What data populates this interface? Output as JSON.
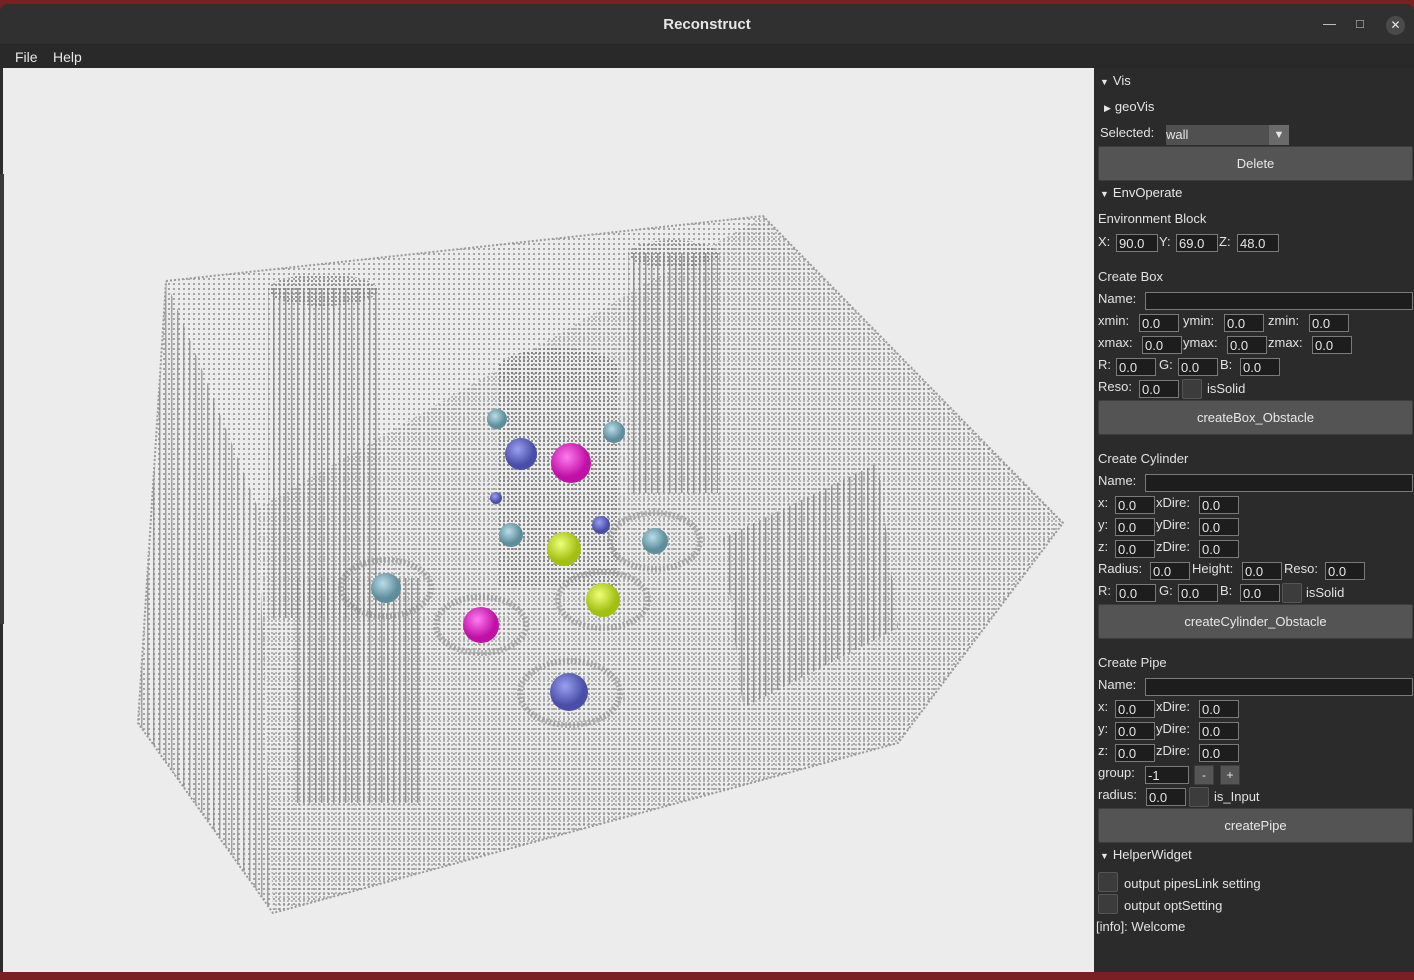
{
  "window": {
    "title": "Reconstruct"
  },
  "menu": [
    "File",
    "Help"
  ],
  "vis": {
    "header": "Vis",
    "geovis": "geoVis",
    "selected_label": "Selected:",
    "selected_value": "wall",
    "delete": "Delete"
  },
  "env": {
    "header": "EnvOperate",
    "block_title": "Environment Block",
    "x_label": "X:",
    "x": "90.0",
    "y_label": "Y:",
    "y": "69.0",
    "z_label": "Z:",
    "z": "48.0"
  },
  "box": {
    "title": "Create Box",
    "name_label": "Name:",
    "name": "",
    "xmin_label": "xmin:",
    "xmin": "0.0",
    "ymin_label": "ymin:",
    "ymin": "0.0",
    "zmin_label": "zmin:",
    "zmin": "0.0",
    "xmax_label": "xmax:",
    "xmax": "0.0",
    "ymax_label": "ymax:",
    "ymax": "0.0",
    "zmax_label": "zmax:",
    "zmax": "0.0",
    "r_label": "R:",
    "r": "0.0",
    "g_label": "G:",
    "g": "0.0",
    "b_label": "B:",
    "b": "0.0",
    "reso_label": "Reso:",
    "reso": "0.0",
    "issolid": "isSolid",
    "button": "createBox_Obstacle"
  },
  "cyl": {
    "title": "Create Cylinder",
    "name_label": "Name:",
    "name": "",
    "x_label": "x:",
    "x": "0.0",
    "y_label": "y:",
    "y": "0.0",
    "z_label": "z:",
    "z": "0.0",
    "xdire_label": "xDire:",
    "xdire": "0.0",
    "ydire_label": "yDire:",
    "ydire": "0.0",
    "zdire_label": "zDire:",
    "zdire": "0.0",
    "radius_label": "Radius:",
    "radius": "0.0",
    "height_label": "Height:",
    "height": "0.0",
    "reso_label": "Reso:",
    "reso": "0.0",
    "r_label": "R:",
    "r": "0.0",
    "g_label": "G:",
    "g": "0.0",
    "b_label": "B:",
    "b": "0.0",
    "issolid": "isSolid",
    "button": "createCylinder_Obstacle"
  },
  "pipe": {
    "title": "Create Pipe",
    "name_label": "Name:",
    "name": "",
    "x_label": "x:",
    "x": "0.0",
    "y_label": "y:",
    "y": "0.0",
    "z_label": "z:",
    "z": "0.0",
    "xdire_label": "xDire:",
    "xdire": "0.0",
    "ydire_label": "yDire:",
    "ydire": "0.0",
    "zdire_label": "zDire:",
    "zdire": "0.0",
    "group_label": "group:",
    "group": "-1",
    "minus": "-",
    "plus": "+",
    "radius_label": "radius:",
    "radius": "0.0",
    "is_input": "is_Input",
    "button": "createPipe"
  },
  "helper": {
    "header": "HelperWidget",
    "pipeslink": "output pipesLink setting",
    "optsetting": "output optSetting",
    "info": "[info]: Welcome"
  },
  "colors": {
    "sphere_magenta": "#e316c8",
    "sphere_yellow": "#c9e61d",
    "sphere_blue": "#5e62c4",
    "sphere_teal": "#7aa9b9",
    "voxel_gray": "#8f8f8f"
  }
}
